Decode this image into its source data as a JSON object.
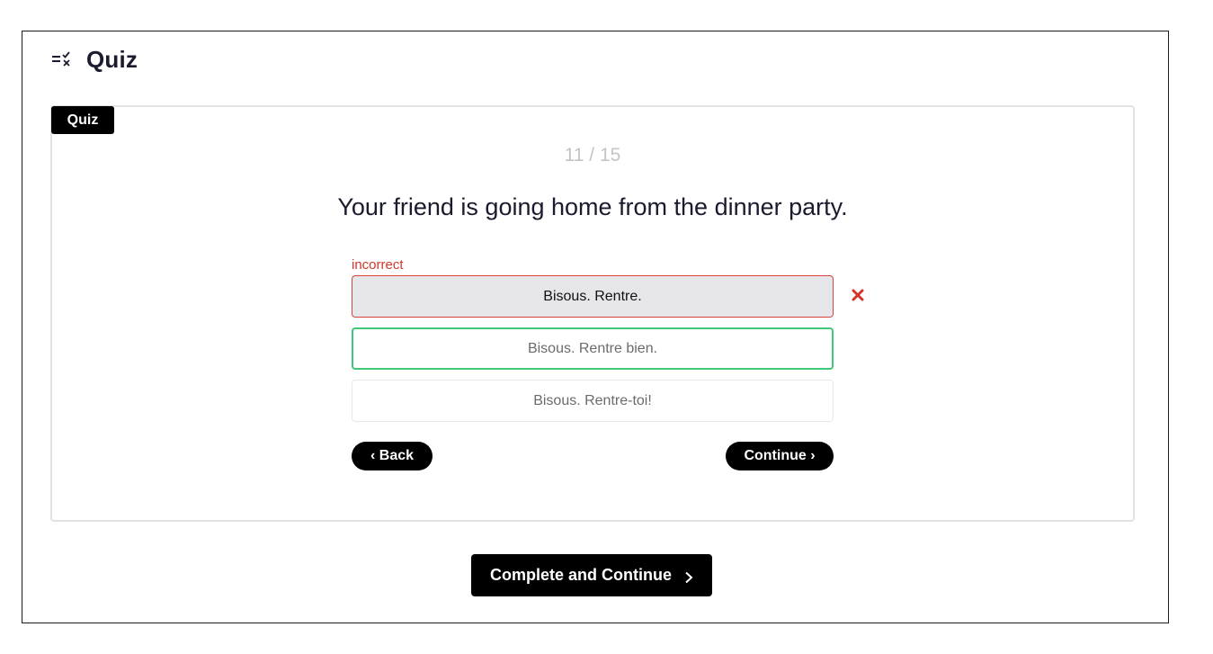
{
  "header": {
    "title": "Quiz",
    "icon": "quiz-checklist-icon"
  },
  "quiz": {
    "tag": "Quiz",
    "counter": "11 / 15",
    "question": "Your friend is going home from the dinner party.",
    "result_label": "incorrect",
    "options": [
      {
        "label": "Bisous. Rentre.",
        "state": "selected-incorrect"
      },
      {
        "label": "Bisous. Rentre bien.",
        "state": "correct"
      },
      {
        "label": "Bisous. Rentre-toi!",
        "state": "neutral"
      }
    ],
    "back_label": "‹ Back",
    "continue_label": "Continue ›"
  },
  "footer": {
    "complete_label": "Complete and Continue"
  },
  "colors": {
    "incorrect": "#d2362b",
    "correct": "#3fc77a",
    "primary": "#000000"
  }
}
